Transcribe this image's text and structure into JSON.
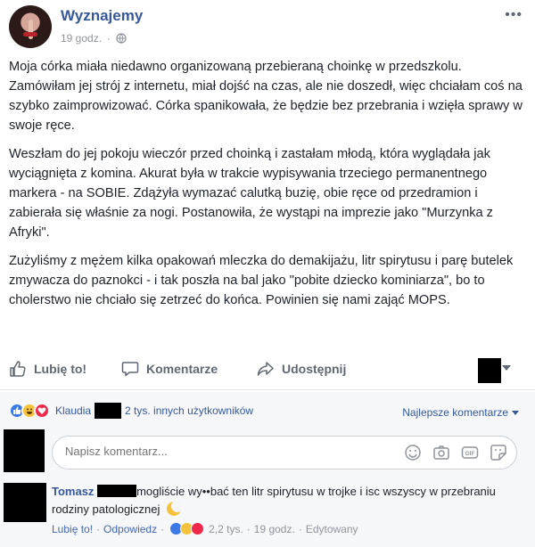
{
  "post": {
    "page_name": "Wyznajemy",
    "time": "19 godz.",
    "separator": "·",
    "more_icon": "more-horizontal-icon",
    "paragraphs": [
      "Moja córka miała niedawno organizowaną przebieraną choinkę w przedszkolu. Zamówiłam jej strój z internetu, miał dojść na czas, ale nie doszedł, więc chciałam coś na szybko zaimprowizować. Córka spanikowała, że będzie bez przebrania i wzięła sprawy w swoje ręce.",
      "Weszłam do jej pokoju wieczór przed choinką i zastałam młodą, która wyglądała jak wyciągnięta z komina. Akurat była w trakcie wypisywania trzeciego permanentnego markera - na SOBIE. Zdążyła wymazać calutką buzię, obie ręce od przedramion i zabierała się właśnie za nogi. Postanowiła, że wystąpi na imprezie jako \"Murzynka z Afryki\".",
      "Zużyliśmy z mężem kilka opakowań mleczka do demakijażu, litr spirytusu i parę butelek zmywacza do paznokci - i tak poszła na bal jako \"pobite dziecko kominiarza\", bo to cholerstwo nie chciało się zetrzeć do końca. Powinien się nami zająć MOPS."
    ]
  },
  "actions": {
    "like": "Lubię to!",
    "comment": "Komentarze",
    "share": "Udostępnij"
  },
  "reactions": {
    "icons": [
      "like",
      "haha",
      "love"
    ],
    "first_name": "Klaudia",
    "others": "2 tys. innych użytkowników",
    "sort": "Najlepsze komentarze"
  },
  "comment_input": {
    "placeholder": "Napisz komentarz..."
  },
  "comment": {
    "author": "Tomasz",
    "text": "mogliście wy••bać ten litr spirytusu w trojke i isc wszyscy w przebraniu rodziny patologicznej",
    "like": "Lubię to!",
    "reply": "Odpowiedz",
    "reaction_count": "2,2 tys.",
    "time": "19 godz.",
    "edited": "Edytowany",
    "dot": "·"
  },
  "colors": {
    "link": "#365899",
    "muted": "#90949c",
    "like_blue": "#3b7ae6",
    "haha_yellow": "#f5c33b",
    "love_red": "#f0284a"
  }
}
